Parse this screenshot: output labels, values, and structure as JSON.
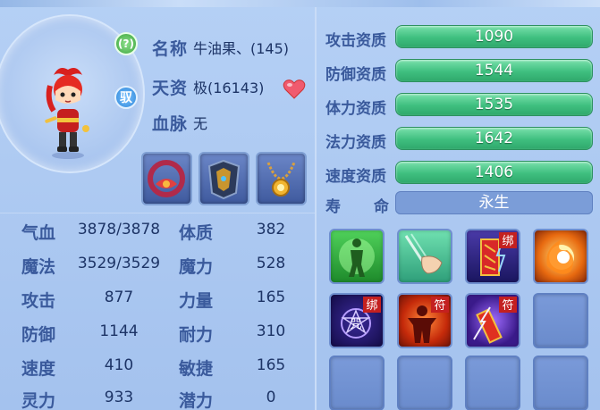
{
  "pet": {
    "name_label": "名称",
    "name_value": "牛油果、(145)",
    "talent_label": "天资",
    "talent_value": "极(16143)",
    "bloodline_label": "血脉",
    "bloodline_value": "无",
    "badge_top": "(?)",
    "badge_mid": "驭"
  },
  "attributes": [
    {
      "label": "气血",
      "value": "3878/3878",
      "label2": "体质",
      "value2": "382"
    },
    {
      "label": "魔法",
      "value": "3529/3529",
      "label2": "魔力",
      "value2": "528"
    },
    {
      "label": "攻击",
      "value": "877",
      "label2": "力量",
      "value2": "165"
    },
    {
      "label": "防御",
      "value": "1144",
      "label2": "耐力",
      "value2": "310"
    },
    {
      "label": "速度",
      "value": "410",
      "label2": "敏捷",
      "value2": "165"
    },
    {
      "label": "灵力",
      "value": "933",
      "label2": "潜力",
      "value2": "0"
    }
  ],
  "aptitudes": [
    {
      "label": "攻击资质",
      "value": "1090"
    },
    {
      "label": "防御资质",
      "value": "1544"
    },
    {
      "label": "体力资质",
      "value": "1535"
    },
    {
      "label": "法力资质",
      "value": "1642"
    },
    {
      "label": "速度资质",
      "value": "1406"
    }
  ],
  "lifespan": {
    "label_a": "寿",
    "label_b": "命",
    "value": "永生"
  },
  "equipment_icons": [
    "collar-icon",
    "armor-icon",
    "necklace-icon"
  ],
  "skills": [
    {
      "icon": "green-figure-skill-icon",
      "badge": ""
    },
    {
      "icon": "hand-strike-skill-icon",
      "badge": ""
    },
    {
      "icon": "bind-scroll-skill-icon",
      "badge": "绑"
    },
    {
      "icon": "fireball-skill-icon",
      "badge": ""
    },
    {
      "icon": "curse-seal-skill-icon",
      "badge": "绑",
      "glyph": "咒"
    },
    {
      "icon": "red-figure-talisman-icon",
      "badge": "符"
    },
    {
      "icon": "lightning-talisman-icon",
      "badge": "符"
    }
  ]
}
